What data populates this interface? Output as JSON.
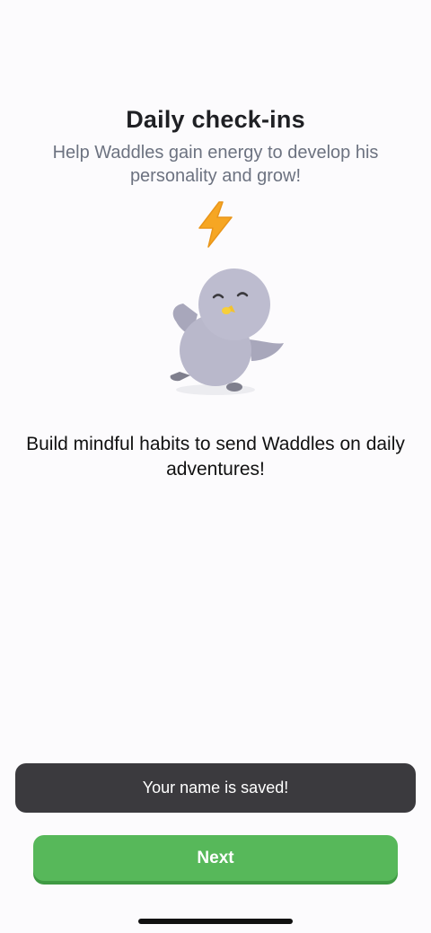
{
  "onboarding": {
    "title": "Daily check-ins",
    "subtitle": "Help Waddles gain energy to develop his personality and grow!",
    "energy_icon": "lightning-bolt-icon",
    "mascot_icon": "penguin-mascot-icon",
    "message": "Build mindful habits to send Waddles on daily adventures!"
  },
  "toast": {
    "text": "Your name is saved!"
  },
  "actions": {
    "next_label": "Next"
  },
  "colors": {
    "background": "#fcfbfd",
    "primary_button": "#57b85a",
    "toast_background": "#3b3a3e",
    "energy": "#f6a623",
    "mascot": "#b9b8cb"
  }
}
